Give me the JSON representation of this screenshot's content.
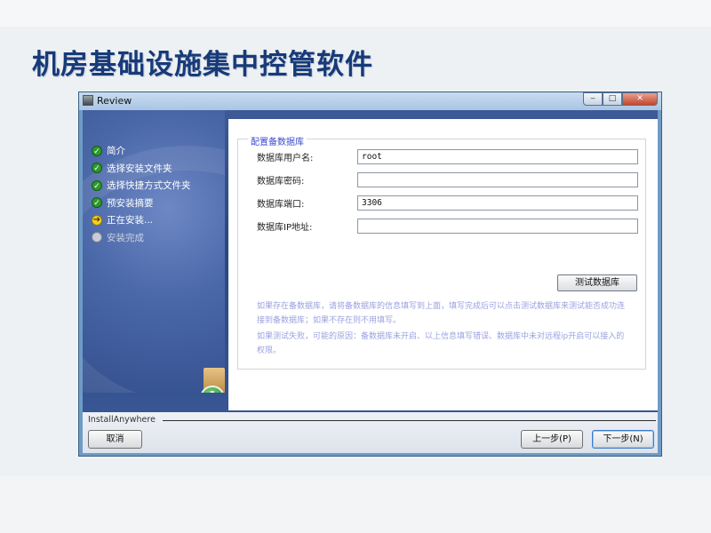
{
  "slide": {
    "title": "机房基础设施集中控管软件"
  },
  "window": {
    "title": "Review",
    "controls": {
      "minimize": "‒",
      "maximize": "□",
      "close": "✕"
    }
  },
  "steps": [
    {
      "label": "简介",
      "status": "done"
    },
    {
      "label": "选择安装文件夹",
      "status": "done"
    },
    {
      "label": "选择快捷方式文件夹",
      "status": "done"
    },
    {
      "label": "预安装摘要",
      "status": "done"
    },
    {
      "label": "正在安装...",
      "status": "current"
    },
    {
      "label": "安装完成",
      "status": "pending"
    }
  ],
  "form": {
    "legend": "配置备数据库",
    "fields": {
      "username": {
        "label": "数据库用户名:",
        "value": "root"
      },
      "password": {
        "label": "数据库密码:",
        "value": ""
      },
      "port": {
        "label": "数据库端口:",
        "value": "3306"
      },
      "ip": {
        "label": "数据库IP地址:",
        "value": ""
      }
    },
    "test_button": "测试数据库",
    "hint1": "如果存在备数据库，请将备数据库的信息填写到上面，填写完成后可以点击测试数据库来测试能否成功连接到备数据库；如果不存在则不用填写。",
    "hint2": "如果测试失败，可能的原因：备数据库未开启、以上信息填写错误、数据库中未对远程ip开启可以接入的权限。"
  },
  "footer": {
    "brand": "InstallAnywhere",
    "cancel": "取消",
    "prev": "上一步(P)",
    "next": "下一步(N)"
  }
}
